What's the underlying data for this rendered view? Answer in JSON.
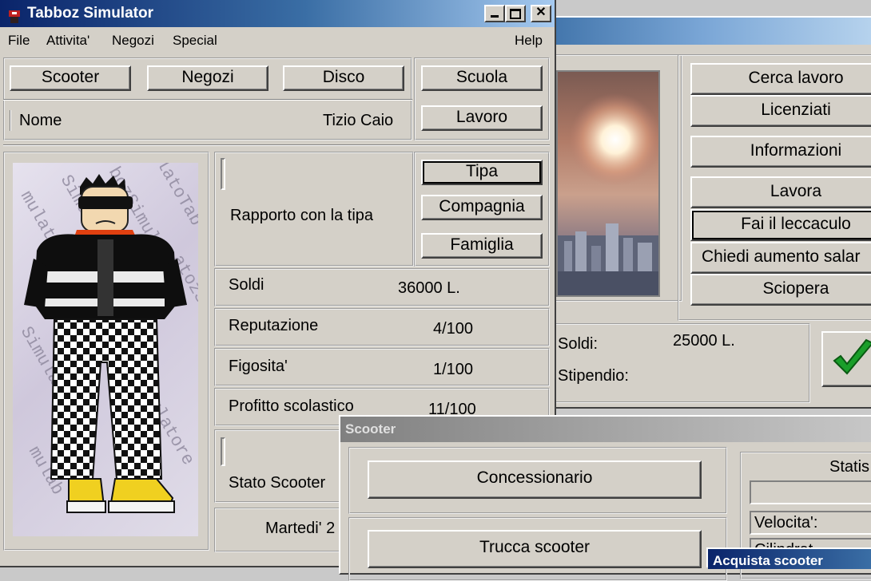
{
  "main_window": {
    "title": "Tabboz Simulator",
    "menu": {
      "file": "File",
      "attivita": "Attivita'",
      "negozi": "Negozi",
      "special": "Special",
      "help": "Help"
    },
    "buttons": {
      "scooter": "Scooter",
      "negozi": "Negozi",
      "disco": "Disco",
      "scuola": "Scuola",
      "lavoro": "Lavoro",
      "tipa": "Tipa",
      "compagnia": "Compagnia",
      "famiglia": "Famiglia"
    },
    "nome_label": "Nome",
    "nome_value": "Tizio Caio",
    "rapporto_label": "Rapporto con la tipa",
    "stats": {
      "soldi_label": "Soldi",
      "soldi_value": "36000 L.",
      "reputazione_label": "Reputazione",
      "reputazione_value": "4/100",
      "figosita_label": "Figosita'",
      "figosita_value": "1/100",
      "profitto_label": "Profitto scolastico",
      "profitto_value": "11/100"
    },
    "stato_scooter_label": "Stato Scooter",
    "day_label": "Martedi' 2"
  },
  "lavoro_window": {
    "buttons": {
      "cerca_lavoro": "Cerca lavoro",
      "licenziati": "Licenziati",
      "informazioni": "Informazioni",
      "lavora": "Lavora",
      "fai_leccaculo": "Fai il leccaculo",
      "chiedi_aumento": "Chiedi aumento salar",
      "sciopera": "Sciopera"
    },
    "soldi_label": "Soldi:",
    "soldi_value": "25000 L.",
    "stipendio_label": "Stipendio:"
  },
  "scooter_window": {
    "title": "Scooter",
    "buttons": {
      "concessionario": "Concessionario",
      "trucca": "Trucca scooter"
    },
    "statistiche_label": "Statis",
    "velocita_label": "Velocita':",
    "cilindrata_label": "Cilindrat"
  },
  "acquista_window": {
    "title": "Acquista scooter"
  },
  "colors": {
    "window_bg": "#d4d0c8",
    "title_active": "#0a246a",
    "ok_check": "#1a9e2a"
  }
}
